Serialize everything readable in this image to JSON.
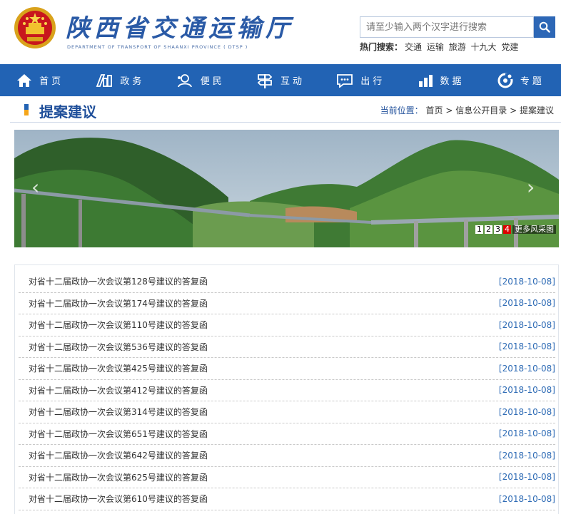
{
  "header": {
    "site_title": "陕西省交通运输厅",
    "site_subtitle": "DEPARTMENT OF TRANSPORT OF SHAANXI PROVINCE ( DTSP )",
    "search_placeholder": "请至少输入两个汉字进行搜索",
    "hot_label": "热门搜索：",
    "hot_keywords": [
      "交通",
      "运输",
      "旅游",
      "十九大",
      "党建"
    ]
  },
  "nav": [
    {
      "label": "首页",
      "icon": "home-icon"
    },
    {
      "label": "政务",
      "icon": "government-icon"
    },
    {
      "label": "便民",
      "icon": "service-icon"
    },
    {
      "label": "互动",
      "icon": "signpost-icon"
    },
    {
      "label": "出行",
      "icon": "message-icon"
    },
    {
      "label": "数据",
      "icon": "bar-chart-icon"
    },
    {
      "label": "专题",
      "icon": "topic-icon"
    }
  ],
  "page": {
    "title": "提案建议",
    "breadcrumb_label": "当前位置：",
    "breadcrumb": [
      "首页",
      "信息公开目录",
      "提案建议"
    ],
    "breadcrumb_sep": ">"
  },
  "banner": {
    "pages": [
      "1",
      "2",
      "3",
      "4"
    ],
    "active_page": "4",
    "more_label": "更多风采图"
  },
  "list": [
    {
      "title": "对省十二届政协一次会议第128号建议的答复函",
      "date": "[2018-10-08]"
    },
    {
      "title": "对省十二届政协一次会议第174号建议的答复函",
      "date": "[2018-10-08]"
    },
    {
      "title": "对省十二届政协一次会议第110号建议的答复函",
      "date": "[2018-10-08]"
    },
    {
      "title": "对省十二届政协一次会议第536号建议的答复函",
      "date": "[2018-10-08]"
    },
    {
      "title": "对省十二届政协一次会议第425号建议的答复函",
      "date": "[2018-10-08]"
    },
    {
      "title": "对省十二届政协一次会议第412号建议的答复函",
      "date": "[2018-10-08]"
    },
    {
      "title": "对省十二届政协一次会议第314号建议的答复函",
      "date": "[2018-10-08]"
    },
    {
      "title": "对省十二届政协一次会议第651号建议的答复函",
      "date": "[2018-10-08]"
    },
    {
      "title": "对省十二届政协一次会议第642号建议的答复函",
      "date": "[2018-10-08]"
    },
    {
      "title": "对省十二届政协一次会议第625号建议的答复函",
      "date": "[2018-10-08]"
    },
    {
      "title": "对省十二届政协一次会议第610号建议的答复函",
      "date": "[2018-10-08]"
    }
  ],
  "colors": {
    "brand_blue": "#2263b4",
    "accent_orange": "#f4a51a",
    "date_blue": "#2e6bb5",
    "pager_active": "#dd0000"
  }
}
